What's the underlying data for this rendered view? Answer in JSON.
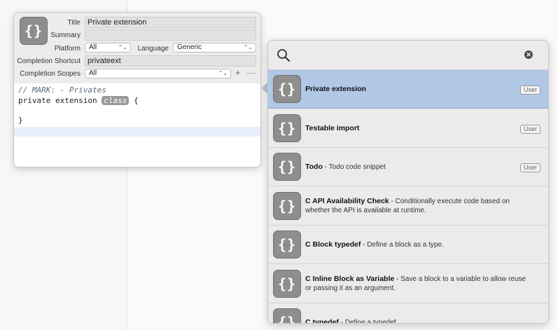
{
  "editor": {
    "labels": {
      "title": "Title",
      "summary": "Summary",
      "platform": "Platform",
      "language": "Language",
      "completion_shortcut": "Completion Shortcut",
      "completion_scopes": "Completion Scopes"
    },
    "values": {
      "title": "Private extension",
      "summary": "",
      "platform": "All",
      "language": "Generic",
      "completion_shortcut": "privateext",
      "completion_scopes": "All"
    },
    "add_scope": "+",
    "remove_scope": "—",
    "icon_glyph": "{}",
    "code": {
      "line1": "// MARK: - Privates",
      "line2_prefix": "private extension ",
      "line2_token": "class",
      "line2_suffix": " {",
      "line4": "}"
    }
  },
  "library": {
    "search_placeholder": "",
    "icon_names": {
      "search": "magnifying-glass-icon",
      "clear": "clear-icon"
    },
    "items": [
      {
        "title": "Private extension",
        "summary": "",
        "badge": "User",
        "selected": true
      },
      {
        "title": "Testable import",
        "summary": "",
        "badge": "User"
      },
      {
        "title": "Todo",
        "summary": " - Todo code snippet",
        "badge": "User"
      },
      {
        "title": "C API Availability Check",
        "summary": " - Conditionally execute code based on whether the API is available at runtime.",
        "badge": ""
      },
      {
        "title": "C Block typedef",
        "summary": " - Define a block as a type.",
        "badge": ""
      },
      {
        "title": "C Inline Block as Variable",
        "summary": " - Save a block to a variable to allow reuse or passing it as an argument.",
        "badge": ""
      },
      {
        "title": "C typedef",
        "summary": " - Define a typedef.",
        "badge": ""
      }
    ]
  },
  "colors": {
    "selected_row": "#b0c7e6",
    "snippet_icon": "#8e8e8e"
  }
}
